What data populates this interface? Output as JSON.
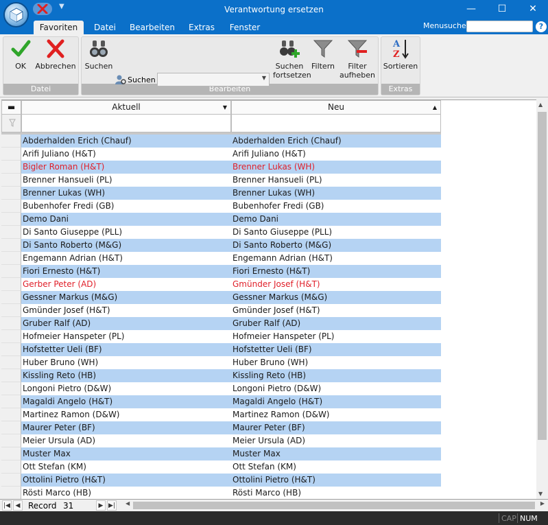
{
  "window": {
    "title": "Verantwortung ersetzen",
    "minimize": "—",
    "maximize": "☐",
    "close": "✕"
  },
  "tabs": [
    {
      "label": "Favoriten",
      "active": true
    },
    {
      "label": "Datei",
      "active": false
    },
    {
      "label": "Bearbeiten",
      "active": false
    },
    {
      "label": "Extras",
      "active": false
    },
    {
      "label": "Fenster",
      "active": false
    }
  ],
  "menusuche": {
    "label": "Menusuche",
    "value": ""
  },
  "help_label": "?",
  "ribbon": {
    "groups": {
      "datei": "Datei",
      "bearbeiten": "Bearbeiten",
      "extras": "Extras"
    },
    "ok": "OK",
    "abbrechen": "Abbrechen",
    "suchen": "Suchen",
    "suchen_small": "Suchen",
    "suchen_combo_value": "",
    "suchen_fortsetzen_1": "Suchen",
    "suchen_fortsetzen_2": "fortsetzen",
    "filtern": "Filtern",
    "filter_aufheben_1": "Filter",
    "filter_aufheben_2": "aufheben",
    "sortieren": "Sortieren"
  },
  "grid": {
    "columns": [
      "Aktuell",
      "Neu"
    ],
    "row_select_header": "▬",
    "filter_icon": "filter-icon",
    "rows": [
      {
        "aktuell": "Abderhalden Erich (Chauf)",
        "neu": "Abderhalden Erich (Chauf)",
        "changed": false,
        "shade": true
      },
      {
        "aktuell": "Arifi Juliano (H&T)",
        "neu": "Arifi Juliano (H&T)",
        "changed": false,
        "shade": false
      },
      {
        "aktuell": "Bigler Roman (H&T)",
        "neu": "Brenner Lukas (WH)",
        "changed": true,
        "shade": true
      },
      {
        "aktuell": "Brenner Hansueli (PL)",
        "neu": "Brenner Hansueli (PL)",
        "changed": false,
        "shade": false
      },
      {
        "aktuell": "Brenner Lukas (WH)",
        "neu": "Brenner Lukas (WH)",
        "changed": false,
        "shade": true
      },
      {
        "aktuell": "Bubenhofer Fredi (GB)",
        "neu": "Bubenhofer Fredi (GB)",
        "changed": false,
        "shade": false
      },
      {
        "aktuell": "Demo Dani",
        "neu": "Demo Dani",
        "changed": false,
        "shade": true
      },
      {
        "aktuell": "Di Santo Giuseppe (PLL)",
        "neu": "Di Santo Giuseppe (PLL)",
        "changed": false,
        "shade": false
      },
      {
        "aktuell": "Di Santo Roberto (M&G)",
        "neu": "Di Santo Roberto (M&G)",
        "changed": false,
        "shade": true
      },
      {
        "aktuell": "Engemann Adrian (H&T)",
        "neu": "Engemann Adrian (H&T)",
        "changed": false,
        "shade": false
      },
      {
        "aktuell": "Fiori Ernesto (H&T)",
        "neu": "Fiori Ernesto (H&T)",
        "changed": false,
        "shade": true
      },
      {
        "aktuell": "Gerber Peter (AD)",
        "neu": "Gmünder Josef (H&T)",
        "changed": true,
        "shade": false
      },
      {
        "aktuell": "Gessner Markus (M&G)",
        "neu": "Gessner Markus (M&G)",
        "changed": false,
        "shade": true
      },
      {
        "aktuell": "Gmünder Josef (H&T)",
        "neu": "Gmünder Josef (H&T)",
        "changed": false,
        "shade": false
      },
      {
        "aktuell": "Gruber Ralf (AD)",
        "neu": "Gruber Ralf (AD)",
        "changed": false,
        "shade": true
      },
      {
        "aktuell": "Hofmeier Hanspeter (PL)",
        "neu": "Hofmeier Hanspeter (PL)",
        "changed": false,
        "shade": false
      },
      {
        "aktuell": "Hofstetter Ueli (BF)",
        "neu": "Hofstetter Ueli (BF)",
        "changed": false,
        "shade": true
      },
      {
        "aktuell": "Huber Bruno (WH)",
        "neu": "Huber Bruno (WH)",
        "changed": false,
        "shade": false
      },
      {
        "aktuell": "Kissling Reto (HB)",
        "neu": "Kissling Reto (HB)",
        "changed": false,
        "shade": true
      },
      {
        "aktuell": "Longoni Pietro (D&W)",
        "neu": "Longoni Pietro (D&W)",
        "changed": false,
        "shade": false
      },
      {
        "aktuell": "Magaldi Angelo (H&T)",
        "neu": "Magaldi Angelo (H&T)",
        "changed": false,
        "shade": true
      },
      {
        "aktuell": "Martinez Ramon (D&W)",
        "neu": "Martinez Ramon (D&W)",
        "changed": false,
        "shade": false
      },
      {
        "aktuell": "Maurer Peter (BF)",
        "neu": "Maurer Peter (BF)",
        "changed": false,
        "shade": true
      },
      {
        "aktuell": "Meier Ursula (AD)",
        "neu": "Meier Ursula (AD)",
        "changed": false,
        "shade": false
      },
      {
        "aktuell": "Muster Max",
        "neu": "Muster Max",
        "changed": false,
        "shade": true
      },
      {
        "aktuell": "Ott Stefan (KM)",
        "neu": "Ott Stefan (KM)",
        "changed": false,
        "shade": false
      },
      {
        "aktuell": "Ottolini Pietro (H&T)",
        "neu": "Ottolini Pietro (H&T)",
        "changed": false,
        "shade": true
      },
      {
        "aktuell": "Rösti Marco (HB)",
        "neu": "Rösti Marco (HB)",
        "changed": false,
        "shade": false
      }
    ]
  },
  "navigator": {
    "label": "Record",
    "record": "31"
  },
  "statusbar": {
    "cap": "CAP",
    "num": "NUM"
  },
  "colors": {
    "titlebar": "#0b70c9",
    "shade_row": "#b5d3f3",
    "changed_text": "#e0202a",
    "normal_text": "#1a1a1a"
  }
}
